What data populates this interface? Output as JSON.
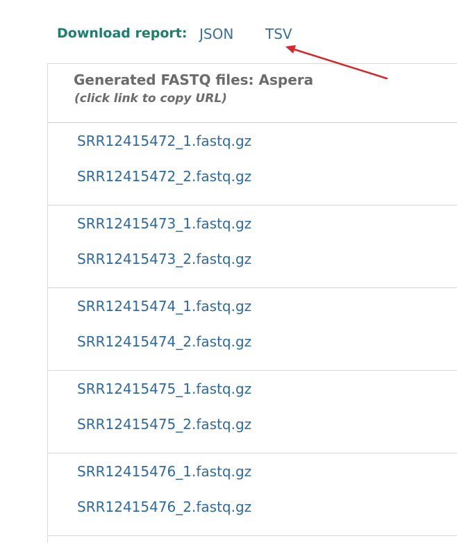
{
  "download": {
    "label": "Download report:",
    "links": [
      "JSON",
      "TSV"
    ]
  },
  "panel": {
    "title": "Generated FASTQ files: Aspera",
    "subtitle": "(click link to copy URL)",
    "groups": [
      {
        "files": [
          "SRR12415472_1.fastq.gz",
          "SRR12415472_2.fastq.gz"
        ]
      },
      {
        "files": [
          "SRR12415473_1.fastq.gz",
          "SRR12415473_2.fastq.gz"
        ]
      },
      {
        "files": [
          "SRR12415474_1.fastq.gz",
          "SRR12415474_2.fastq.gz"
        ]
      },
      {
        "files": [
          "SRR12415475_1.fastq.gz",
          "SRR12415475_2.fastq.gz"
        ]
      },
      {
        "files": [
          "SRR12415476_1.fastq.gz",
          "SRR12415476_2.fastq.gz"
        ]
      }
    ]
  },
  "colors": {
    "label_green": "#1a7f6e",
    "link_blue": "#2e6aa1",
    "header_gray": "#6b6b6b",
    "annotation_red": "#d9262b"
  }
}
